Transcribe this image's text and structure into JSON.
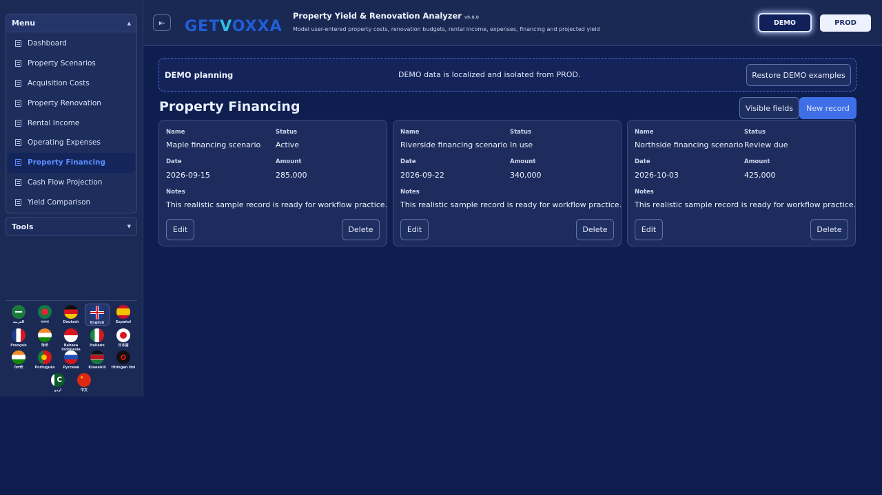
{
  "sidebar": {
    "menu_title": "Menu",
    "tools_title": "Tools",
    "items": [
      {
        "label": "Dashboard"
      },
      {
        "label": "Property Scenarios"
      },
      {
        "label": "Acquisition Costs"
      },
      {
        "label": "Property Renovation"
      },
      {
        "label": "Rental Income"
      },
      {
        "label": "Operating Expenses"
      },
      {
        "label": "Property Financing",
        "active": true
      },
      {
        "label": "Cash Flow Projection"
      },
      {
        "label": "Yield Comparison"
      }
    ],
    "languages": [
      {
        "label": "العربية"
      },
      {
        "label": "বাংলা"
      },
      {
        "label": "Deutsch"
      },
      {
        "label": "English",
        "selected": true
      },
      {
        "label": "Español"
      },
      {
        "label": "Français"
      },
      {
        "label": "हिन्दी"
      },
      {
        "label": "Bahasa Indonesia"
      },
      {
        "label": "Italiano"
      },
      {
        "label": "日本語"
      },
      {
        "label": "ਪੰਜਾਬੀ"
      },
      {
        "label": "Português"
      },
      {
        "label": "Русский"
      },
      {
        "label": "Kiswahili"
      },
      {
        "label": "tlhIngan Hol"
      },
      {
        "label": "اردو"
      },
      {
        "label": "中文"
      }
    ]
  },
  "header": {
    "logo_text_a": "GET",
    "logo_text_v": "V",
    "logo_text_b": "OXXA",
    "title": "Property Yield & Renovation Analyzer",
    "version": "v9.0.0",
    "subtitle": "Model user-entered property costs, renovation budgets, rental income, expenses, financing and projected yield",
    "demo_label": "DEMO",
    "prod_label": "PROD"
  },
  "banner": {
    "title": "DEMO planning",
    "message": "DEMO data is localized and isolated from PROD.",
    "restore_label": "Restore DEMO examples"
  },
  "section": {
    "title": "Property Financing",
    "visible_fields_label": "Visible fields",
    "new_record_label": "New record"
  },
  "field_labels": {
    "name": "Name",
    "status": "Status",
    "date": "Date",
    "amount": "Amount",
    "notes": "Notes",
    "edit": "Edit",
    "delete": "Delete"
  },
  "records": [
    {
      "name": "Maple financing scenario",
      "status": "Active",
      "date": "2026-09-15",
      "amount": "285,000",
      "notes": "This realistic sample record is ready for workflow practice."
    },
    {
      "name": "Riverside financing scenario",
      "status": "In use",
      "date": "2026-09-22",
      "amount": "340,000",
      "notes": "This realistic sample record is ready for workflow practice."
    },
    {
      "name": "Northside financing scenario",
      "status": "Review due",
      "date": "2026-10-03",
      "amount": "425,000",
      "notes": "This realistic sample record is ready for workflow practice."
    }
  ],
  "colors": {
    "accent": "#3f6fe6",
    "active_menu_text": "#5b8cff",
    "background": "#0d1e4f"
  }
}
